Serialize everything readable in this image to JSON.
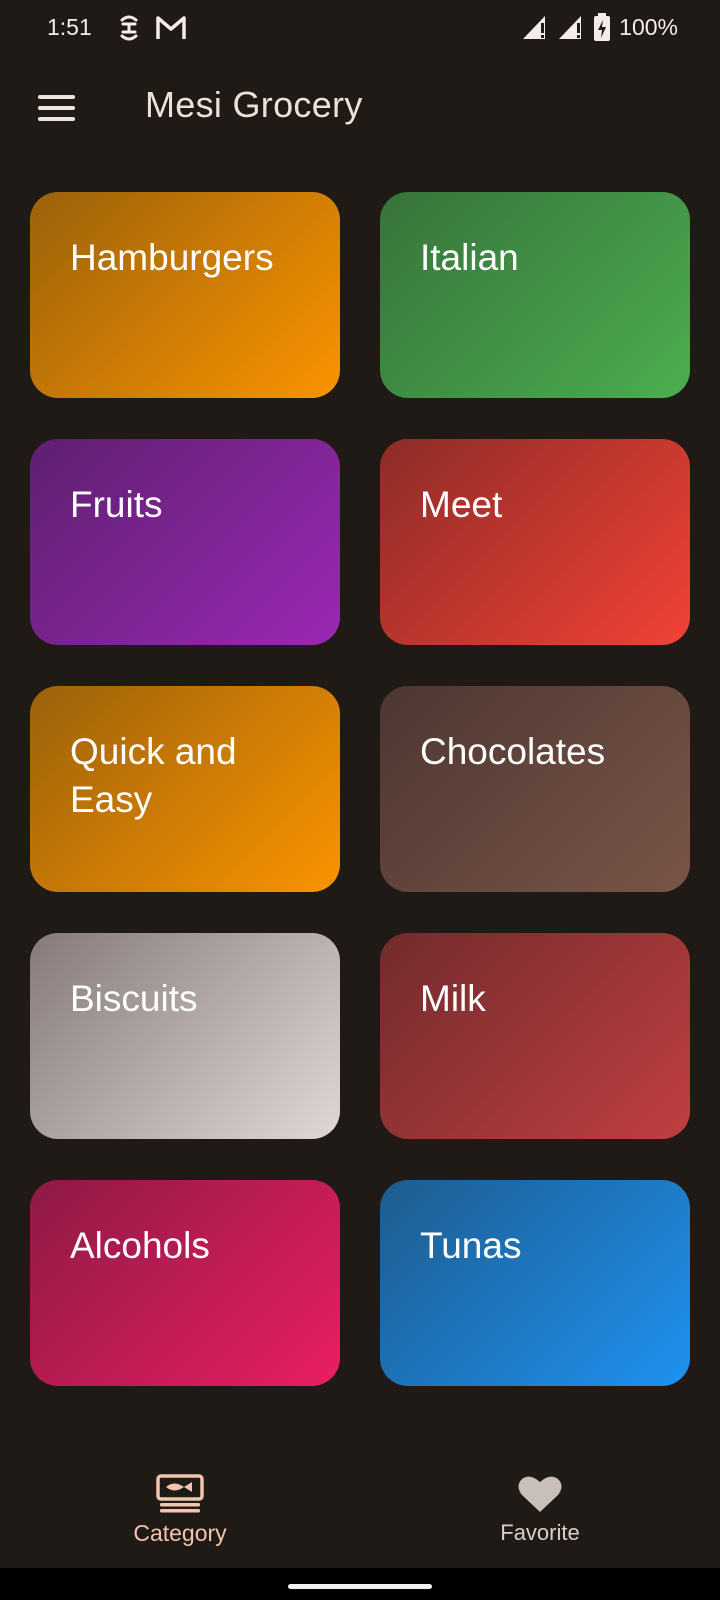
{
  "status_bar": {
    "time": "1:51",
    "left_icons": [
      "accessibility-icon",
      "gmail-icon"
    ],
    "right_icons": [
      "signal-icon",
      "signal-icon",
      "battery-charging-icon"
    ],
    "battery": "100%"
  },
  "app_bar": {
    "title": "Mesi Grocery",
    "menu_icon": "hamburger-menu-icon"
  },
  "categories": [
    {
      "label": "Hamburgers",
      "colors": [
        "#9b620a",
        "#fb9300"
      ]
    },
    {
      "label": "Italian",
      "colors": [
        "#38733a",
        "#4bae50"
      ]
    },
    {
      "label": "Fruits",
      "colors": [
        "#5e2070",
        "#9b28b4"
      ]
    },
    {
      "label": "Meet",
      "colors": [
        "#8e2c28",
        "#f24236"
      ]
    },
    {
      "label": "Quick and Easy",
      "colors": [
        "#9b620a",
        "#fb9300"
      ]
    },
    {
      "label": "Chocolates",
      "colors": [
        "#4d3732",
        "#7a5548"
      ]
    },
    {
      "label": "Biscuits",
      "colors": [
        "#857a79",
        "#e0d7d6"
      ]
    },
    {
      "label": "Milk",
      "colors": [
        "#722b2d",
        "#c03f41"
      ]
    },
    {
      "label": "Alcohols",
      "colors": [
        "#8e1a44",
        "#ea1e63"
      ]
    },
    {
      "label": "Tunas",
      "colors": [
        "#1e5c8f",
        "#1f92f1"
      ]
    }
  ],
  "bottom_nav": {
    "items": [
      {
        "label": "Category",
        "icon": "category-fish-icon",
        "selected": true
      },
      {
        "label": "Favorite",
        "icon": "heart-icon",
        "selected": false
      }
    ]
  },
  "colors": {
    "background": "#201a17",
    "nav_selected": "#f0c4ae",
    "nav_unselected": "#d9cfc9"
  }
}
